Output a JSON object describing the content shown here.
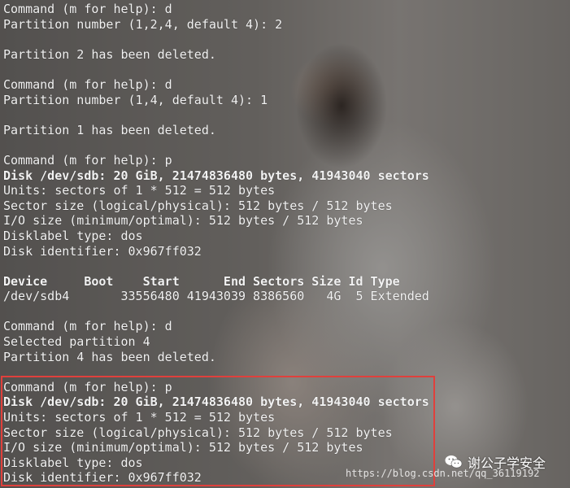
{
  "terminal": {
    "lines": [
      {
        "text": "Command (m for help): d",
        "bold": false
      },
      {
        "text": "Partition number (1,2,4, default 4): 2",
        "bold": false
      },
      {
        "text": "",
        "bold": false
      },
      {
        "text": "Partition 2 has been deleted.",
        "bold": false
      },
      {
        "text": "",
        "bold": false
      },
      {
        "text": "Command (m for help): d",
        "bold": false
      },
      {
        "text": "Partition number (1,4, default 4): 1",
        "bold": false
      },
      {
        "text": "",
        "bold": false
      },
      {
        "text": "Partition 1 has been deleted.",
        "bold": false
      },
      {
        "text": "",
        "bold": false
      },
      {
        "text": "Command (m for help): p",
        "bold": false
      },
      {
        "text": "Disk /dev/sdb: 20 GiB, 21474836480 bytes, 41943040 sectors",
        "bold": true
      },
      {
        "text": "Units: sectors of 1 * 512 = 512 bytes",
        "bold": false
      },
      {
        "text": "Sector size (logical/physical): 512 bytes / 512 bytes",
        "bold": false
      },
      {
        "text": "I/O size (minimum/optimal): 512 bytes / 512 bytes",
        "bold": false
      },
      {
        "text": "Disklabel type: dos",
        "bold": false
      },
      {
        "text": "Disk identifier: 0x967ff032",
        "bold": false
      },
      {
        "text": "",
        "bold": false
      },
      {
        "text": "Device     Boot    Start      End Sectors Size Id Type",
        "bold": true
      },
      {
        "text": "/dev/sdb4       33556480 41943039 8386560   4G  5 Extended",
        "bold": false
      },
      {
        "text": "",
        "bold": false
      },
      {
        "text": "Command (m for help): d",
        "bold": false
      },
      {
        "text": "Selected partition 4",
        "bold": false
      },
      {
        "text": "Partition 4 has been deleted.",
        "bold": false
      },
      {
        "text": "",
        "bold": false
      },
      {
        "text": "Command (m for help): p",
        "bold": false
      },
      {
        "text": "Disk /dev/sdb: 20 GiB, 21474836480 bytes, 41943040 sectors",
        "bold": true
      },
      {
        "text": "Units: sectors of 1 * 512 = 512 bytes",
        "bold": false
      },
      {
        "text": "Sector size (logical/physical): 512 bytes / 512 bytes",
        "bold": false
      },
      {
        "text": "I/O size (minimum/optimal): 512 bytes / 512 bytes",
        "bold": false
      },
      {
        "text": "Disklabel type: dos",
        "bold": false
      },
      {
        "text": "Disk identifier: 0x967ff032",
        "bold": false
      }
    ]
  },
  "highlight_color": "#e0403c",
  "watermark": {
    "icon": "wechat-icon",
    "account": "谢公子学安全",
    "url": "https://blog.csdn.net/qq_36119192"
  }
}
